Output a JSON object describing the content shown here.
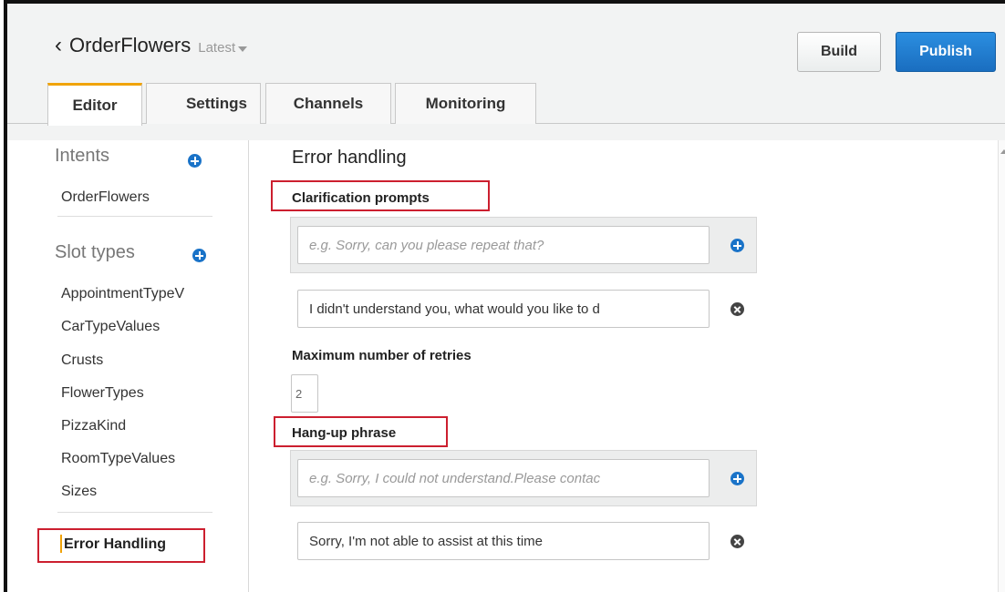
{
  "header": {
    "bot_name": "OrderFlowers",
    "version": "Latest",
    "build_label": "Build",
    "publish_label": "Publish",
    "accent_color": "#1a73c8"
  },
  "tabs": [
    {
      "label": "Editor",
      "active": true
    },
    {
      "label": "Settings",
      "active": false
    },
    {
      "label": "Channels",
      "active": false
    },
    {
      "label": "Monitoring",
      "active": false
    }
  ],
  "sidebar": {
    "intents_heading": "Intents",
    "intents": [
      "OrderFlowers"
    ],
    "slot_types_heading": "Slot types",
    "slot_types": [
      "AppointmentTypeV",
      "CarTypeValues",
      "Crusts",
      "FlowerTypes",
      "PizzaKind",
      "RoomTypeValues",
      "Sizes"
    ],
    "error_handling_label": "Error Handling"
  },
  "main": {
    "title": "Error handling",
    "clarification": {
      "label": "Clarification prompts",
      "placeholder": "e.g. Sorry, can you please repeat that?",
      "value": "I didn't understand you, what would you like to d"
    },
    "retries": {
      "label": "Maximum number of retries",
      "value": "2"
    },
    "hangup": {
      "label": "Hang-up phrase",
      "placeholder": "e.g. Sorry, I could not understand.Please contac",
      "value": "Sorry, I'm not able to assist at this time"
    }
  },
  "highlight_color": "#cc1f2f"
}
